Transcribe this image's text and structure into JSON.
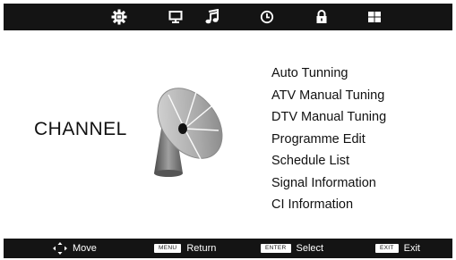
{
  "topbar": {
    "tabs": [
      {
        "icon": "picture-gear-icon",
        "selected": true
      },
      {
        "icon": "monitor-icon",
        "selected": false
      },
      {
        "icon": "music-note-icon",
        "selected": false
      },
      {
        "icon": "clock-icon",
        "selected": false
      },
      {
        "icon": "lock-icon",
        "selected": false
      },
      {
        "icon": "windows-grid-icon",
        "selected": false
      }
    ]
  },
  "section": {
    "title": "CHANNEL",
    "illustration": "satellite-dish-icon"
  },
  "menu": {
    "items": [
      "Auto Tunning",
      "ATV Manual Tuning",
      "DTV Manual Tuning",
      "Programme Edit",
      "Schedule List",
      "Signal Information",
      "CI Information"
    ]
  },
  "bottombar": {
    "move": {
      "icon": "four-way-arrow-icon",
      "label": "Move"
    },
    "return": {
      "key": "MENU",
      "label": "Return"
    },
    "select": {
      "key": "ENTER",
      "label": "Select"
    },
    "exit": {
      "key": "EXIT",
      "label": "Exit"
    }
  },
  "colors": {
    "bar_background": "#141414",
    "page_background": "#ffffff",
    "text": "#111111"
  }
}
